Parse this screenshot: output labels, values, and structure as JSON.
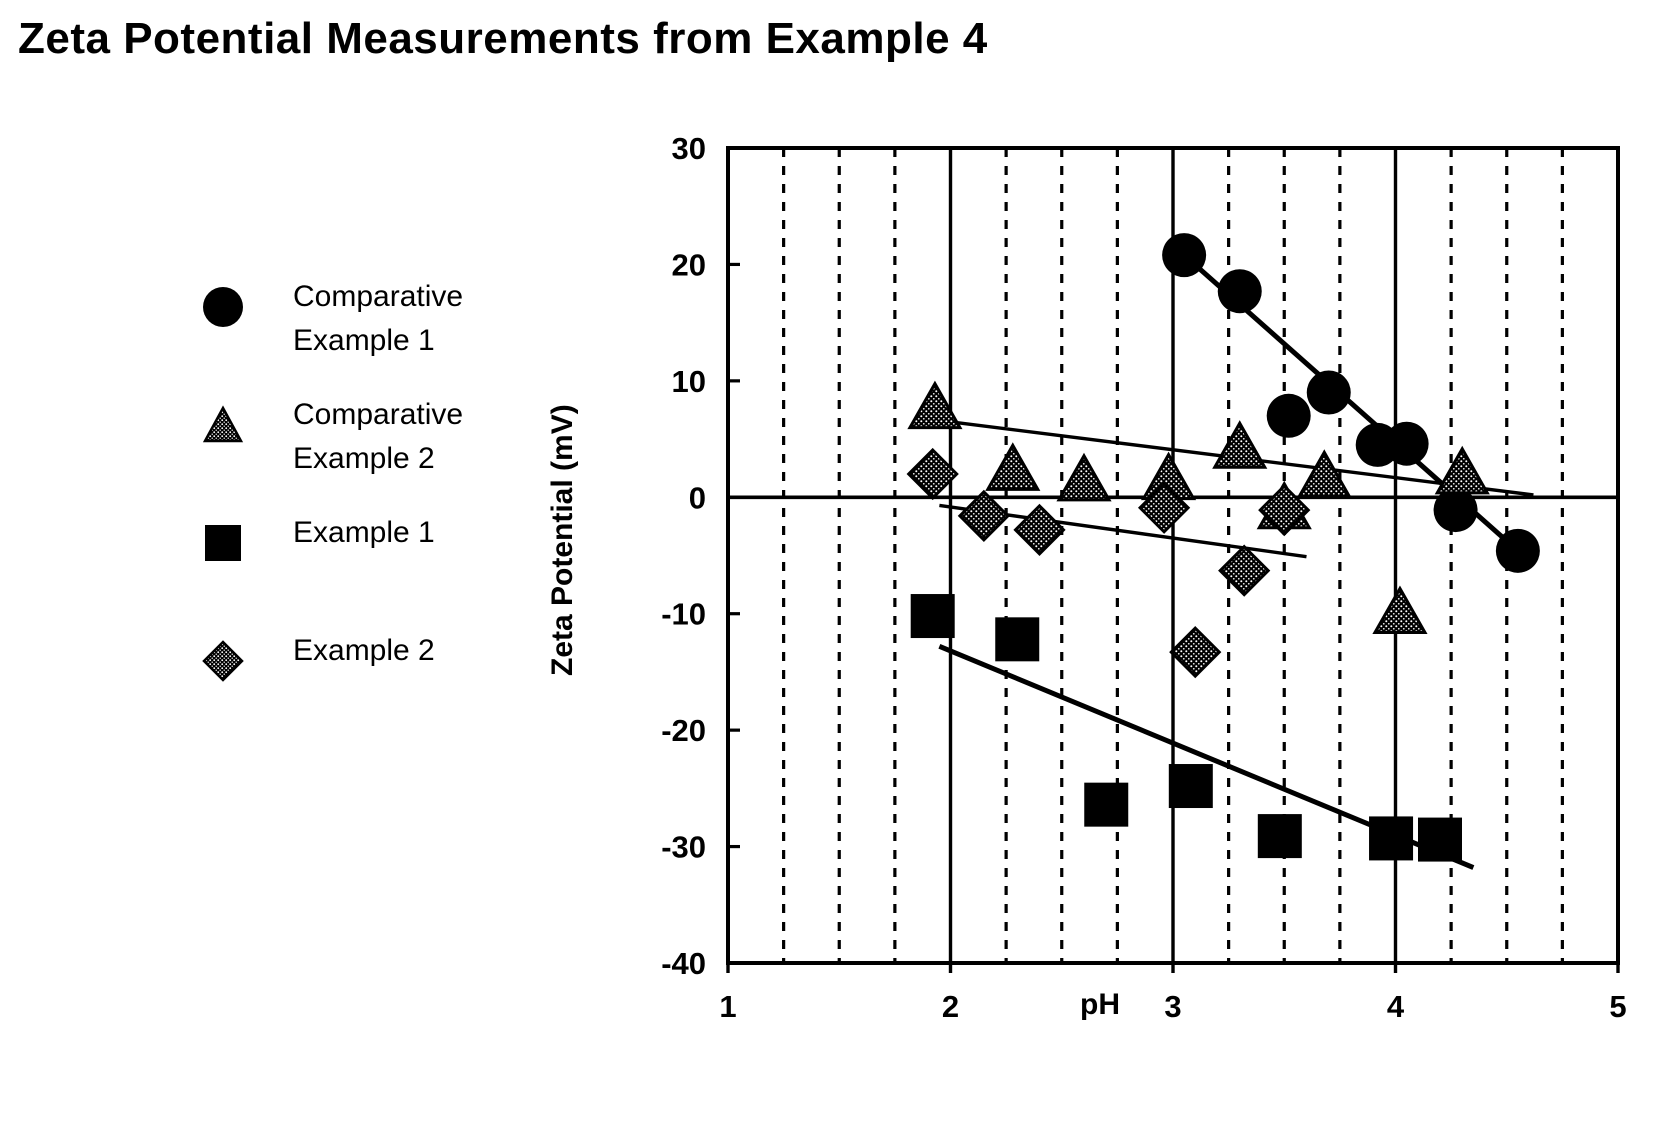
{
  "title": "Zeta Potential Measurements from Example 4",
  "legend": {
    "position": "left",
    "items": [
      {
        "label": "Comparative\nExample 1",
        "marker": "circle-filled-icon"
      },
      {
        "label": "Comparative\nExample 2",
        "marker": "triangle-stippled-icon"
      },
      {
        "label": "Example 1",
        "marker": "square-filled-icon"
      },
      {
        "label": "Example 2",
        "marker": "diamond-stippled-icon"
      }
    ]
  },
  "axes": {
    "xlabel": "pH",
    "ylabel": "Zeta Potential (mV)",
    "xticks": [
      "1",
      "2",
      "3",
      "4",
      "5"
    ],
    "yticks": [
      "30",
      "20",
      "10",
      "0",
      "-10",
      "-20",
      "-30",
      "-40"
    ]
  },
  "colors": {
    "ink": "#000000",
    "background": "#ffffff"
  },
  "chart_data": {
    "type": "scatter",
    "title": "Zeta Potential Measurements from Example 4",
    "xlabel": "pH",
    "ylabel": "Zeta Potential (mV)",
    "xlim": [
      1,
      5
    ],
    "ylim": [
      -40,
      30
    ],
    "xticks": [
      1,
      2,
      3,
      4,
      5
    ],
    "yticks": [
      30,
      20,
      10,
      0,
      -10,
      -20,
      -30,
      -40
    ],
    "grid": {
      "major_vertical_at": [
        2,
        3,
        4
      ],
      "minor_vertical_dotted_every": 0.25,
      "zero_line": true,
      "horizontal_grid": false
    },
    "legend_position": "left-outside",
    "series": [
      {
        "name": "Comparative Example 1",
        "marker": "circle",
        "fill": "solid",
        "points": [
          {
            "x": 3.05,
            "y": 20.8
          },
          {
            "x": 3.3,
            "y": 17.7
          },
          {
            "x": 3.7,
            "y": 9.0
          },
          {
            "x": 3.52,
            "y": 7.0
          },
          {
            "x": 3.92,
            "y": 4.5
          },
          {
            "x": 4.05,
            "y": 4.6
          },
          {
            "x": 4.27,
            "y": -1.1
          },
          {
            "x": 4.55,
            "y": -4.6
          }
        ],
        "trendline": {
          "x1": 3.05,
          "y1": 20.8,
          "x2": 4.55,
          "y2": -4.6
        }
      },
      {
        "name": "Comparative Example 2",
        "marker": "triangle",
        "fill": "stippled",
        "points": [
          {
            "x": 1.93,
            "y": 7.7
          },
          {
            "x": 2.28,
            "y": 2.4
          },
          {
            "x": 2.6,
            "y": 1.5
          },
          {
            "x": 2.98,
            "y": 1.6
          },
          {
            "x": 3.3,
            "y": 4.3
          },
          {
            "x": 3.5,
            "y": -0.9
          },
          {
            "x": 3.68,
            "y": 1.8
          },
          {
            "x": 4.02,
            "y": -9.9
          },
          {
            "x": 4.3,
            "y": 2.1
          }
        ],
        "trendline": {
          "x1": 1.95,
          "y1": 6.6,
          "x2": 4.62,
          "y2": 0.2
        }
      },
      {
        "name": "Example 1",
        "marker": "square",
        "fill": "solid",
        "points": [
          {
            "x": 1.92,
            "y": -10.2
          },
          {
            "x": 2.3,
            "y": -12.2
          },
          {
            "x": 2.7,
            "y": -26.4
          },
          {
            "x": 3.08,
            "y": -24.8
          },
          {
            "x": 3.48,
            "y": -29.1
          },
          {
            "x": 3.98,
            "y": -29.3
          },
          {
            "x": 4.2,
            "y": -29.4
          }
        ],
        "trendline": {
          "x1": 1.95,
          "y1": -12.8,
          "x2": 4.35,
          "y2": -31.8
        }
      },
      {
        "name": "Example 2",
        "marker": "diamond",
        "fill": "stippled",
        "points": [
          {
            "x": 1.92,
            "y": 2.0
          },
          {
            "x": 2.15,
            "y": -1.6
          },
          {
            "x": 2.4,
            "y": -2.8
          },
          {
            "x": 2.96,
            "y": -0.9
          },
          {
            "x": 3.1,
            "y": -13.3
          },
          {
            "x": 3.32,
            "y": -6.3
          },
          {
            "x": 3.5,
            "y": -1.1
          }
        ],
        "trendline": {
          "x1": 1.95,
          "y1": -0.7,
          "x2": 3.6,
          "y2": -5.1
        }
      }
    ]
  }
}
